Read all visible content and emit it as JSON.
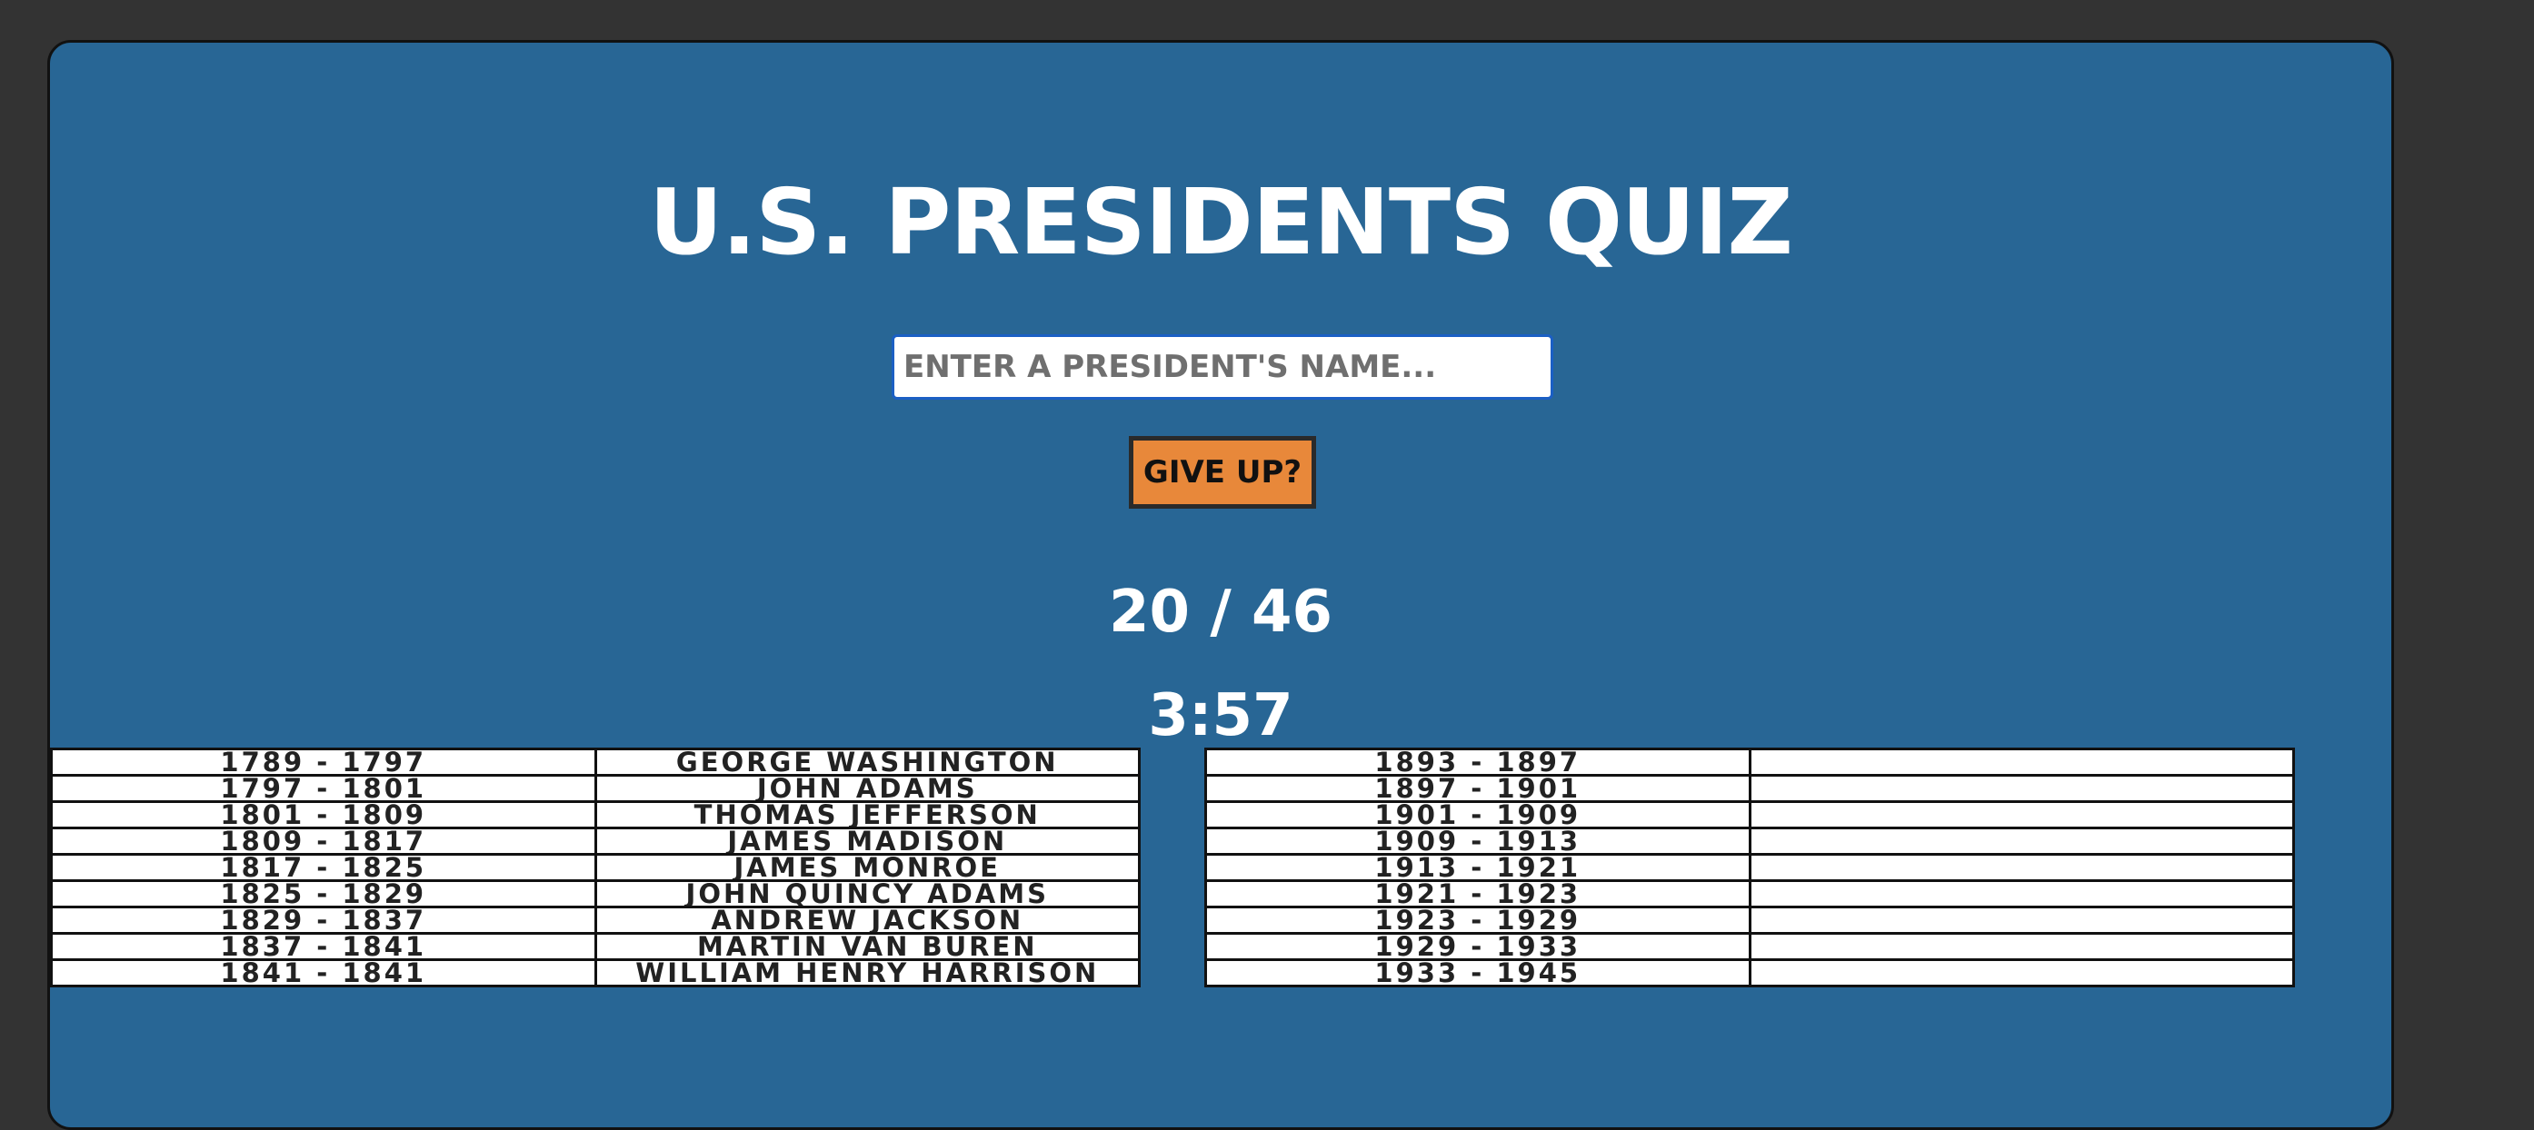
{
  "title": "U.S. PRESIDENTS QUIZ",
  "input": {
    "placeholder": "ENTER A PRESIDENT'S NAME...",
    "value": ""
  },
  "give_up_label": "GIVE UP?",
  "score": "20 / 46",
  "timer": "3:57",
  "colors": {
    "background": "#333333",
    "panel": "#286695",
    "button": "#e8883a",
    "input_border": "#1b5fc4"
  },
  "left_table": [
    {
      "years": "1789 - 1797",
      "name": "GEORGE WASHINGTON"
    },
    {
      "years": "1797 - 1801",
      "name": "JOHN ADAMS"
    },
    {
      "years": "1801 - 1809",
      "name": "THOMAS JEFFERSON"
    },
    {
      "years": "1809 - 1817",
      "name": "JAMES MADISON"
    },
    {
      "years": "1817 - 1825",
      "name": "JAMES MONROE"
    },
    {
      "years": "1825 - 1829",
      "name": "JOHN QUINCY ADAMS"
    },
    {
      "years": "1829 - 1837",
      "name": "ANDREW JACKSON"
    },
    {
      "years": "1837 - 1841",
      "name": "MARTIN VAN BUREN"
    },
    {
      "years": "1841 - 1841",
      "name": "WILLIAM HENRY HARRISON"
    }
  ],
  "right_table": [
    {
      "years": "1893 - 1897",
      "name": ""
    },
    {
      "years": "1897 - 1901",
      "name": ""
    },
    {
      "years": "1901 - 1909",
      "name": ""
    },
    {
      "years": "1909 - 1913",
      "name": ""
    },
    {
      "years": "1913 - 1921",
      "name": ""
    },
    {
      "years": "1921 - 1923",
      "name": ""
    },
    {
      "years": "1923 - 1929",
      "name": ""
    },
    {
      "years": "1929 - 1933",
      "name": ""
    },
    {
      "years": "1933 - 1945",
      "name": ""
    }
  ]
}
